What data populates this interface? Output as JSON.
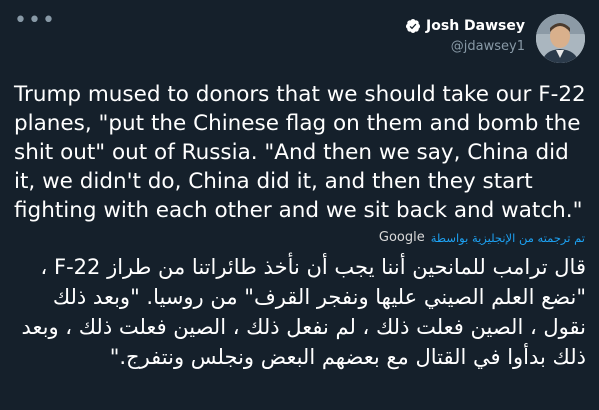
{
  "header": {
    "more_icon": "more-dots-icon",
    "author_name": "Josh Dawsey",
    "author_handle": "@jdawsey1",
    "verified_icon": "verified-badge-icon",
    "avatar": "profile-photo"
  },
  "tweet": {
    "text": "Trump mused to donors that we should take our F-22 planes, \"put the Chinese flag on them and bomb the shit out\" out of Russia. \"And then we say, China did it, we didn't do, China did it, and then they start fighting with each other and we sit back and watch.\"",
    "translated_by_label": "تم ترجمته من الإنجليزية بواسطة",
    "translator": "Google",
    "translation": "قال ترامب للمانحين أننا يجب أن نأخذ طائراتنا من طراز F-22 ، \"نضع العلم الصيني عليها ونفجر القرف\" من روسيا. \"وبعد ذلك نقول ، الصين فعلت ذلك ، لم نفعل ذلك ، الصين فعلت ذلك ، وبعد ذلك بدأوا في القتال مع بعضهم البعض ونجلس ونتفرج.\""
  },
  "colors": {
    "background": "#15202b",
    "text": "#ffffff",
    "muted": "#8899a6",
    "link": "#1da1f2"
  }
}
